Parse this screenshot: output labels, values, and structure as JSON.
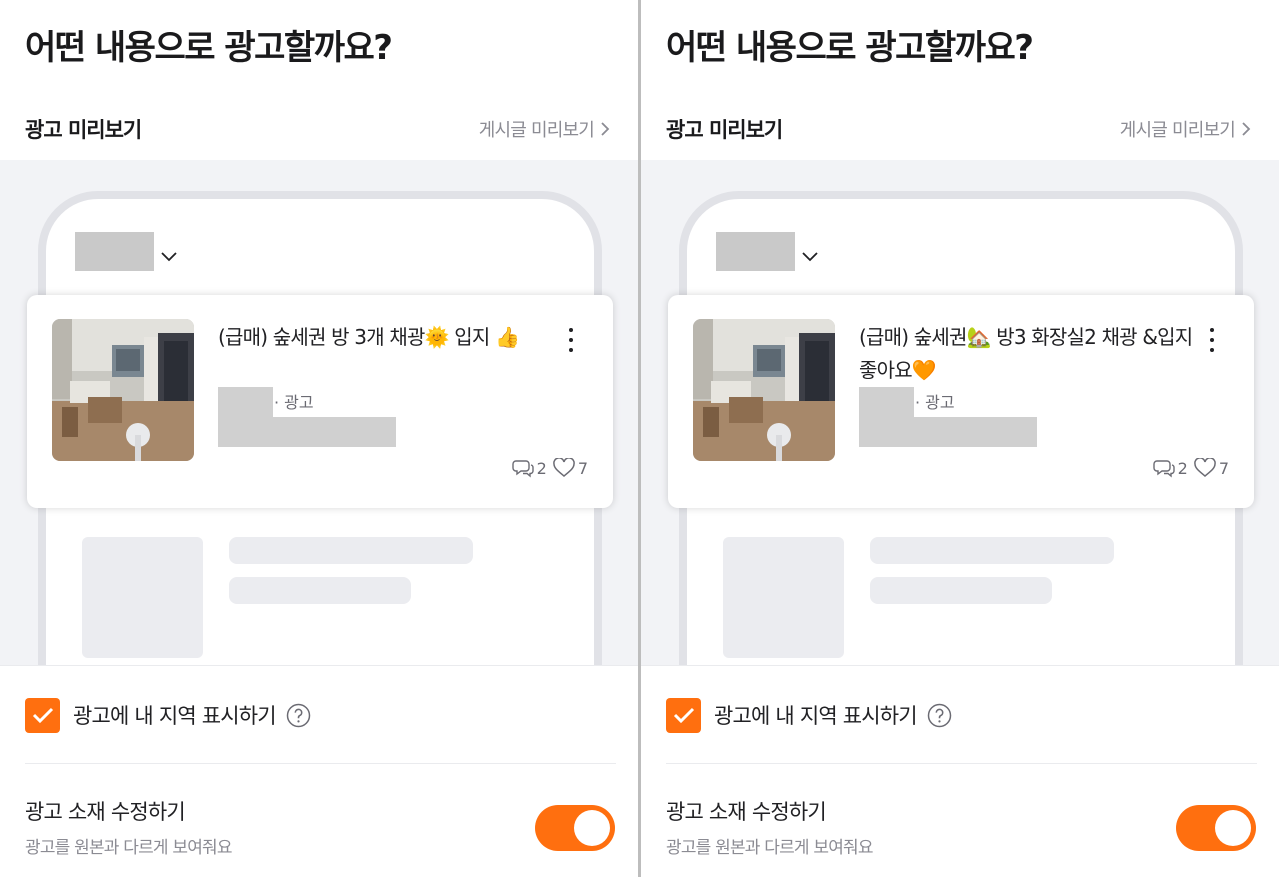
{
  "panels": [
    {
      "page_title": "어떤 내용으로 광고할까요?",
      "preview_label": "광고 미리보기",
      "post_preview_link": "게시글 미리보기",
      "ad": {
        "title": "(급매) 숲세권 방 3개 채광🌞 입지 👍",
        "tag": "· 광고",
        "comments": "2",
        "likes": "7"
      },
      "show_region": {
        "label": "광고에 내 지역 표시하기",
        "checked": true
      },
      "edit_creative": {
        "title": "광고 소재 수정하기",
        "subtitle": "광고를 원본과 다르게 보여줘요",
        "enabled": true
      }
    },
    {
      "page_title": "어떤 내용으로 광고할까요?",
      "preview_label": "광고 미리보기",
      "post_preview_link": "게시글 미리보기",
      "ad": {
        "title": "(급매) 숲세권🏡 방3 화장실2 채광 &입지 좋아요🧡",
        "tag": "· 광고",
        "comments": "2",
        "likes": "7"
      },
      "show_region": {
        "label": "광고에 내 지역 표시하기",
        "checked": true
      },
      "edit_creative": {
        "title": "광고 소재 수정하기",
        "subtitle": "광고를 원본과 다르게 보여줘요",
        "enabled": true
      }
    }
  ],
  "icons": {
    "link_arrow": "chevron-right-icon",
    "location_dropdown": "chevron-down-icon",
    "more": "more-vertical-icon",
    "comments": "comment-icon",
    "likes": "heart-icon",
    "checkbox": "check-icon",
    "help": "question-circle-icon"
  },
  "colors": {
    "accent": "#ff6f0f",
    "preview_background": "#f2f3f6",
    "text_primary": "#212124",
    "text_secondary": "#8b8b93"
  }
}
